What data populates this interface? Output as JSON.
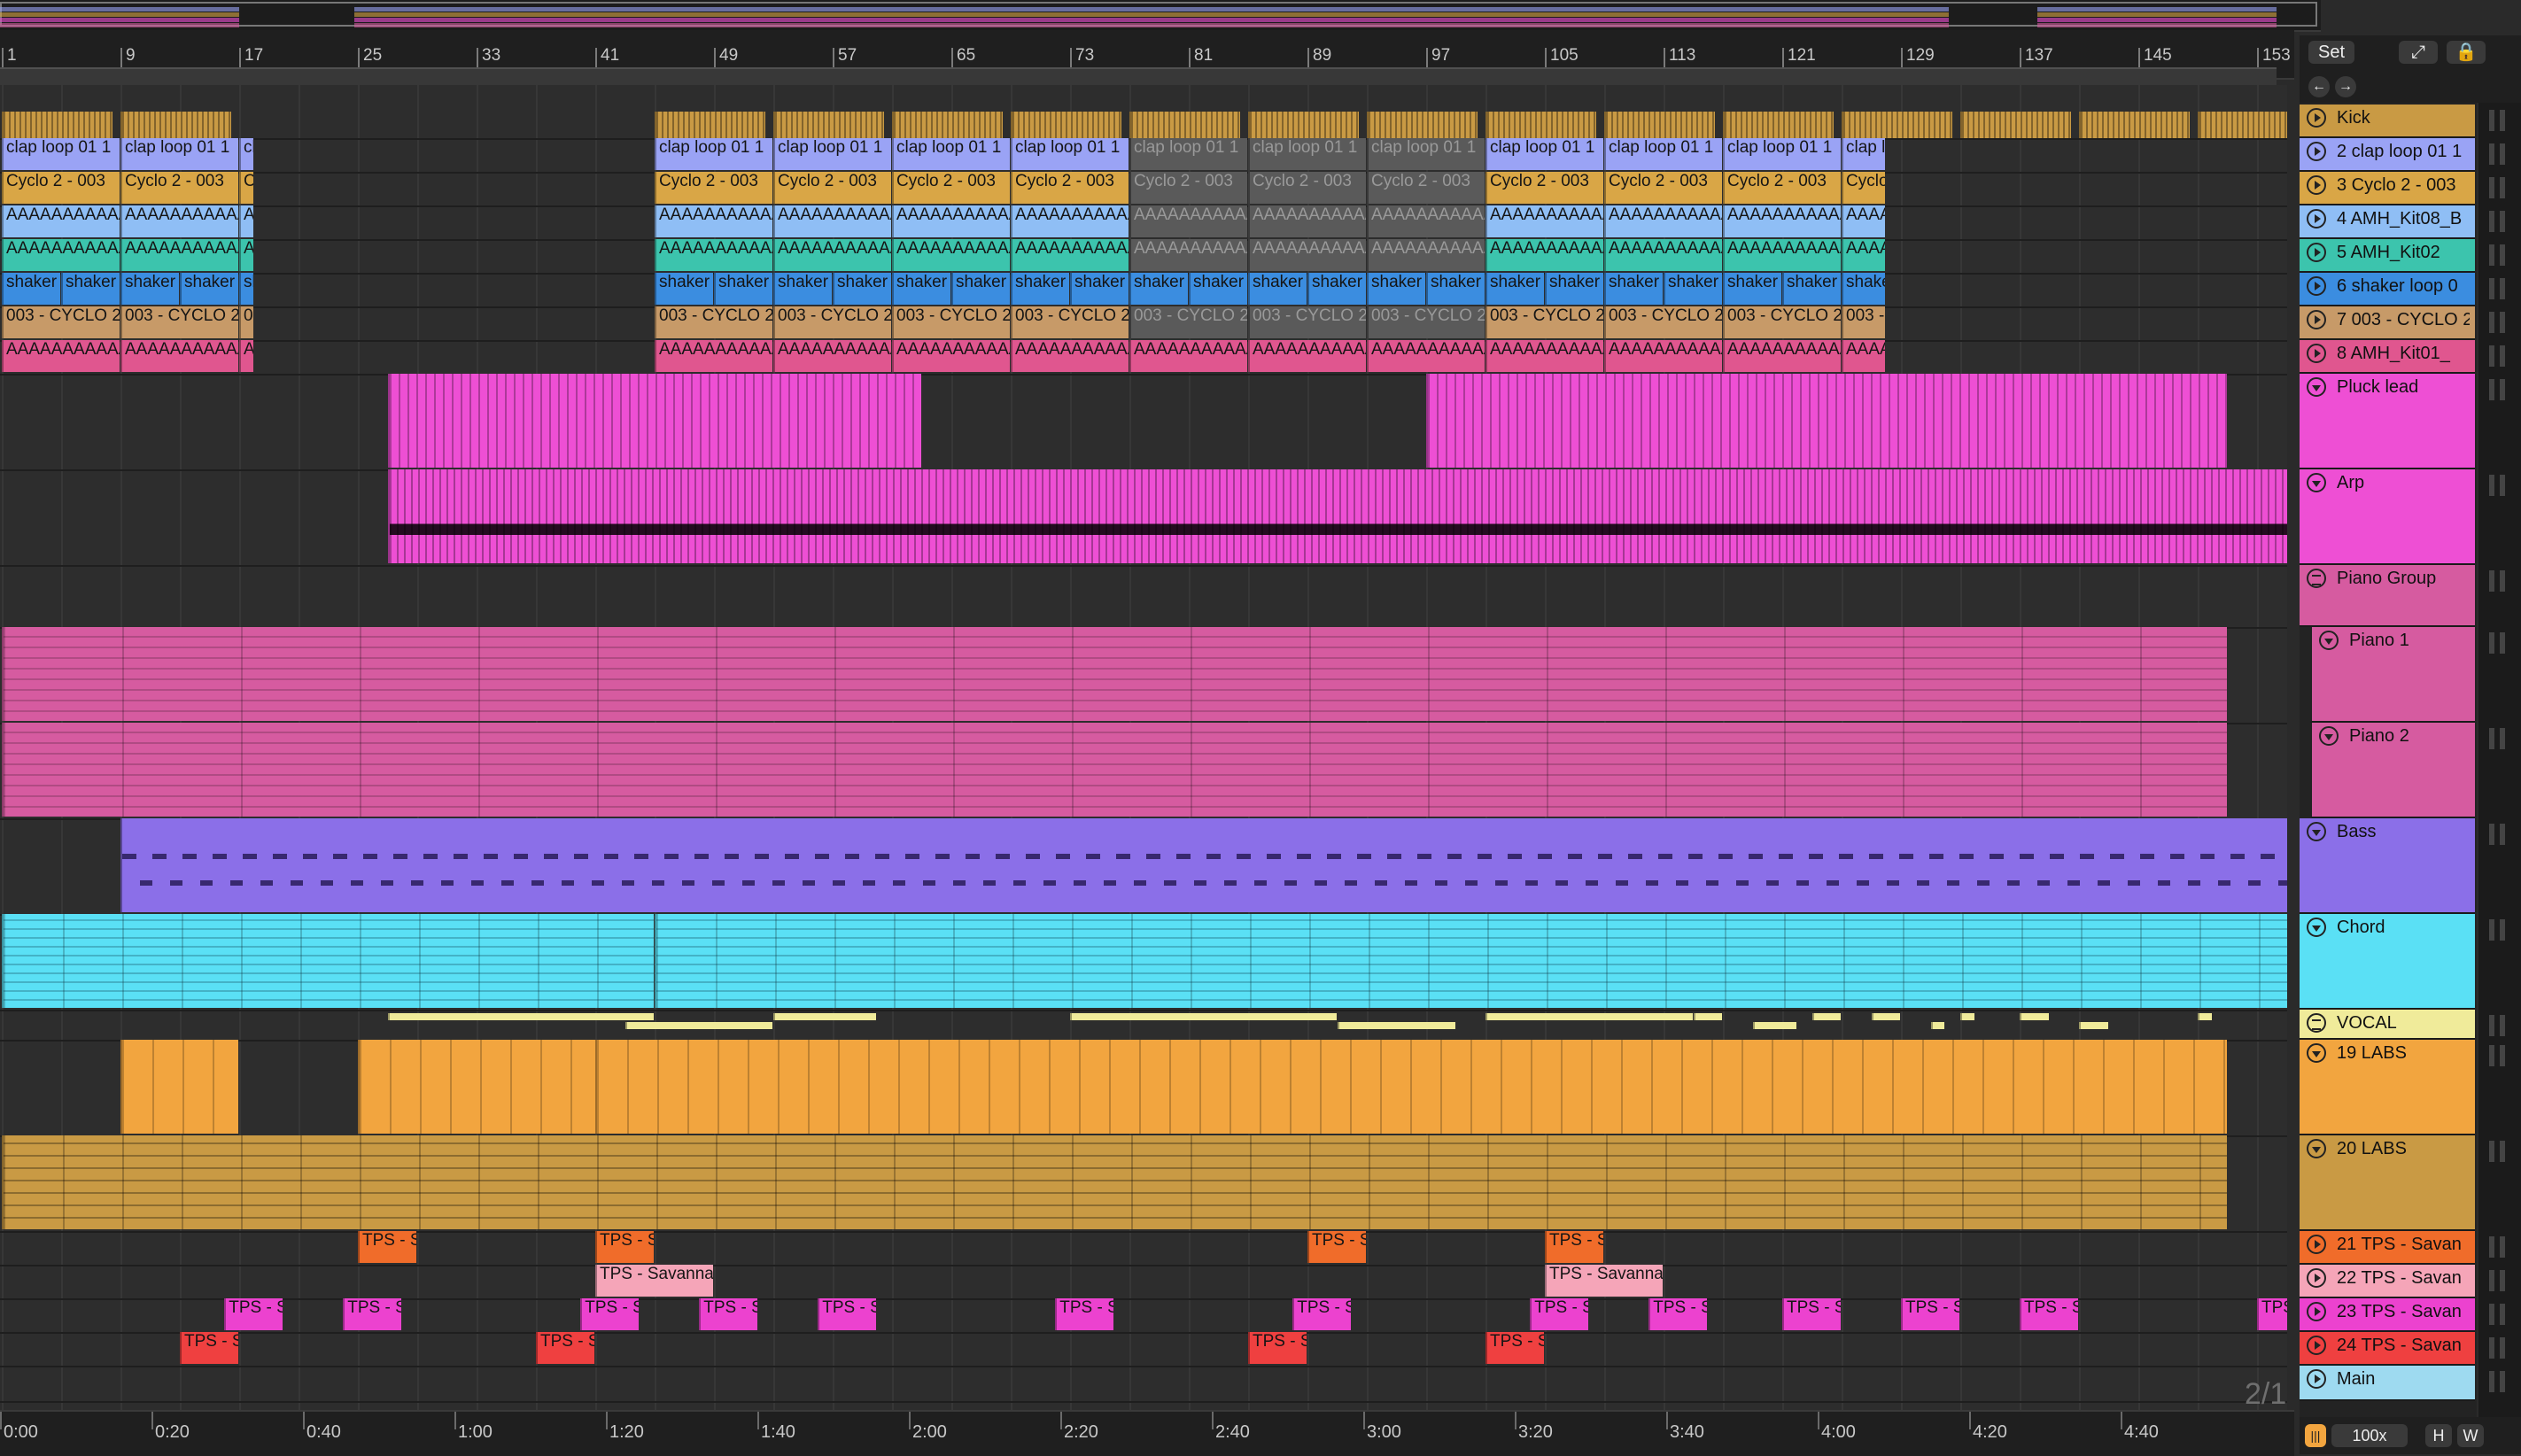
{
  "colors": {
    "kick": "#c99a44",
    "clap": "#9aa3f5",
    "cyclo": "#d9a646",
    "amh08": "#8fbef5",
    "amh02": "#3cc4ad",
    "shaker": "#3b8de0",
    "cyclo003": "#c79a68",
    "amh01": "#e0568f",
    "pluck": "#ee4fd4",
    "arp": "#ee4fd4",
    "piano_group": "#d65ba0",
    "piano": "#d65ba0",
    "bass": "#8b6fe8",
    "chord": "#5ae0f5",
    "vocal": "#f0eb9a",
    "labs19": "#f2a53f",
    "labs20": "#c99a44",
    "tps21": "#f06c2a",
    "tps22": "#f5a5b8",
    "tps23": "#ec42cf",
    "tps24": "#ef4040",
    "main": "#9edaf0",
    "inactive": "#5a5a5a"
  },
  "ruler": {
    "bars": [
      "1",
      "9",
      "17",
      "25",
      "33",
      "41",
      "49",
      "57",
      "65",
      "73",
      "81",
      "89",
      "97",
      "105",
      "113",
      "121",
      "129",
      "137",
      "145",
      "153"
    ]
  },
  "time_ruler": {
    "labels": [
      "0:00",
      "0:20",
      "0:40",
      "1:00",
      "1:20",
      "1:40",
      "2:00",
      "2:20",
      "2:40",
      "3:00",
      "3:20",
      "3:40",
      "4:00",
      "4:20",
      "4:40"
    ]
  },
  "topright": {
    "set_label": "Set"
  },
  "bottomright": {
    "zoom": "100x",
    "h_label": "H",
    "w_label": "W"
  },
  "signature": "2/1",
  "tracks": [
    {
      "id": "kick",
      "name": "Kick",
      "color_key": "kick",
      "icon": "play"
    },
    {
      "id": "clap",
      "name": "2 clap loop 01 1",
      "color_key": "clap",
      "icon": "play",
      "clip_label": "clap loop 01 1"
    },
    {
      "id": "cyclo",
      "name": "3 Cyclo 2 - 003",
      "color_key": "cyclo",
      "icon": "play",
      "clip_label": "Cyclo 2 - 003"
    },
    {
      "id": "amh08",
      "name": "4 AMH_Kit08_B",
      "color_key": "amh08",
      "icon": "play",
      "clip_label": "AAAAAAAAAAAAAAAAAAAA"
    },
    {
      "id": "amh02",
      "name": "5 AMH_Kit02",
      "color_key": "amh02",
      "icon": "play",
      "clip_label": "AAAAAAAAAAAAAAAAAAAA"
    },
    {
      "id": "shaker",
      "name": "6 shaker loop 0",
      "color_key": "shaker",
      "icon": "play",
      "clip_label": "shaker"
    },
    {
      "id": "cyclo003",
      "name": "7 003 - CYCLO 2",
      "color_key": "cyclo003",
      "icon": "play",
      "clip_label": "003 - CYCLO 2"
    },
    {
      "id": "amh01",
      "name": "8 AMH_Kit01_",
      "color_key": "amh01",
      "icon": "play",
      "clip_label": "AAAAAAAAAAAAAAAAAAAA"
    },
    {
      "id": "pluck",
      "name": "Pluck lead",
      "color_key": "pluck",
      "icon": "fold"
    },
    {
      "id": "arp",
      "name": "Arp",
      "color_key": "arp",
      "icon": "fold"
    },
    {
      "id": "pianogrp",
      "name": "Piano Group",
      "color_key": "piano_group",
      "icon": "group"
    },
    {
      "id": "piano1",
      "name": "Piano 1",
      "color_key": "piano",
      "icon": "fold"
    },
    {
      "id": "piano2",
      "name": "Piano 2",
      "color_key": "piano",
      "icon": "fold"
    },
    {
      "id": "bass",
      "name": "Bass",
      "color_key": "bass",
      "icon": "fold"
    },
    {
      "id": "chord",
      "name": "Chord",
      "color_key": "chord",
      "icon": "fold"
    },
    {
      "id": "vocal",
      "name": "VOCAL",
      "color_key": "vocal",
      "icon": "group"
    },
    {
      "id": "labs19",
      "name": "19 LABS",
      "color_key": "labs19",
      "icon": "fold"
    },
    {
      "id": "labs20",
      "name": "20 LABS",
      "color_key": "labs20",
      "icon": "fold"
    },
    {
      "id": "tps21",
      "name": "21 TPS - Savan",
      "color_key": "tps21",
      "icon": "play",
      "clip_label": "TPS - S"
    },
    {
      "id": "tps22",
      "name": "22 TPS - Savan",
      "color_key": "tps22",
      "icon": "play",
      "clip_label": "TPS - Savanna"
    },
    {
      "id": "tps23",
      "name": "23 TPS - Savan",
      "color_key": "tps23",
      "icon": "play",
      "clip_label": "TPS - S"
    },
    {
      "id": "tps24",
      "name": "24 TPS - Savan",
      "color_key": "tps24",
      "icon": "play",
      "clip_label": "TPS - S"
    },
    {
      "id": "main",
      "name": "Main",
      "color_key": "main",
      "icon": "play"
    }
  ]
}
